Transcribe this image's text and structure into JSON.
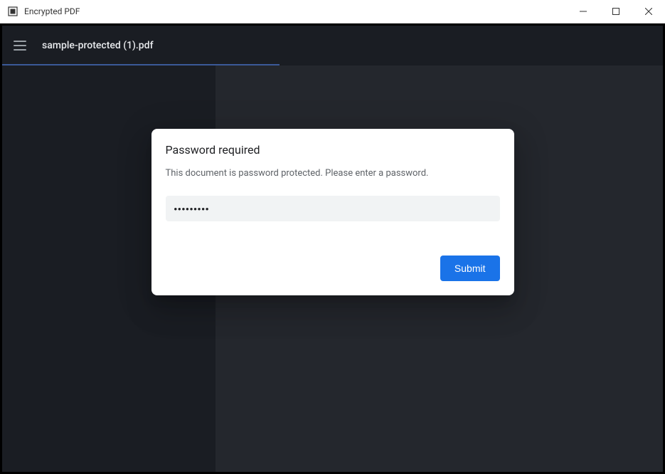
{
  "window": {
    "title": "Encrypted PDF"
  },
  "toolbar": {
    "filename": "sample-protected (1).pdf"
  },
  "modal": {
    "title": "Password required",
    "description": "This document is password protected. Please enter a password.",
    "password_value": "•••••••••",
    "submit_label": "Submit"
  }
}
